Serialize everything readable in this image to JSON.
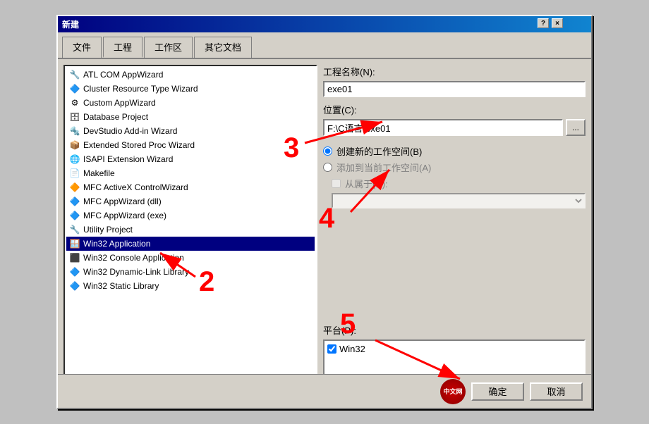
{
  "dialog": {
    "title": "新建",
    "help_label": "?",
    "close_label": "×"
  },
  "tabs": [
    {
      "label": "文件",
      "active": false
    },
    {
      "label": "工程",
      "active": true
    },
    {
      "label": "工作区",
      "active": false
    },
    {
      "label": "其它文档",
      "active": false
    }
  ],
  "project_list": [
    {
      "id": "atl-com",
      "icon": "🔧",
      "label": "ATL COM AppWizard"
    },
    {
      "id": "cluster",
      "icon": "🔷",
      "label": "Cluster Resource Type Wizard"
    },
    {
      "id": "custom",
      "icon": "⚙",
      "label": "Custom AppWizard"
    },
    {
      "id": "database",
      "icon": "🗄",
      "label": "Database Project"
    },
    {
      "id": "devstudio",
      "icon": "🔩",
      "label": "DevStudio Add-in Wizard"
    },
    {
      "id": "ext-stored",
      "icon": "📦",
      "label": "Extended Stored Proc Wizard"
    },
    {
      "id": "isapi",
      "icon": "🌐",
      "label": "ISAPI Extension Wizard"
    },
    {
      "id": "makefile",
      "icon": "📄",
      "label": "Makefile"
    },
    {
      "id": "mfc-activex",
      "icon": "🔶",
      "label": "MFC ActiveX ControlWizard"
    },
    {
      "id": "mfc-dll",
      "icon": "🔷",
      "label": "MFC AppWizard (dll)"
    },
    {
      "id": "mfc-exe",
      "icon": "🔷",
      "label": "MFC AppWizard (exe)"
    },
    {
      "id": "utility",
      "icon": "🔧",
      "label": "Utility Project"
    },
    {
      "id": "win32-app",
      "icon": "🪟",
      "label": "Win32 Application"
    },
    {
      "id": "win32-console",
      "icon": "⬛",
      "label": "Win32 Console Application"
    },
    {
      "id": "win32-dll",
      "icon": "🔷",
      "label": "Win32 Dynamic-Link Library"
    },
    {
      "id": "win32-static",
      "icon": "🔷",
      "label": "Win32 Static Library"
    }
  ],
  "right": {
    "project_name_label": "工程名称(N):",
    "project_name_value": "exe01",
    "location_label": "位置(C):",
    "location_value": "F:\\C语言\\exe01",
    "browse_label": "...",
    "create_new_workspace_label": "创建新的工作空间(B)",
    "add_to_workspace_label": "添加到当前工作空间(A)",
    "dependency_label": "从属于(D):",
    "platform_label": "平台(P):",
    "platform_item": "Win32",
    "platform_checked": true
  },
  "footer": {
    "ok_label": "确定",
    "cancel_label": "取消"
  },
  "annotations": {
    "num2": "2",
    "num3": "3",
    "num4": "4",
    "num5": "5"
  }
}
